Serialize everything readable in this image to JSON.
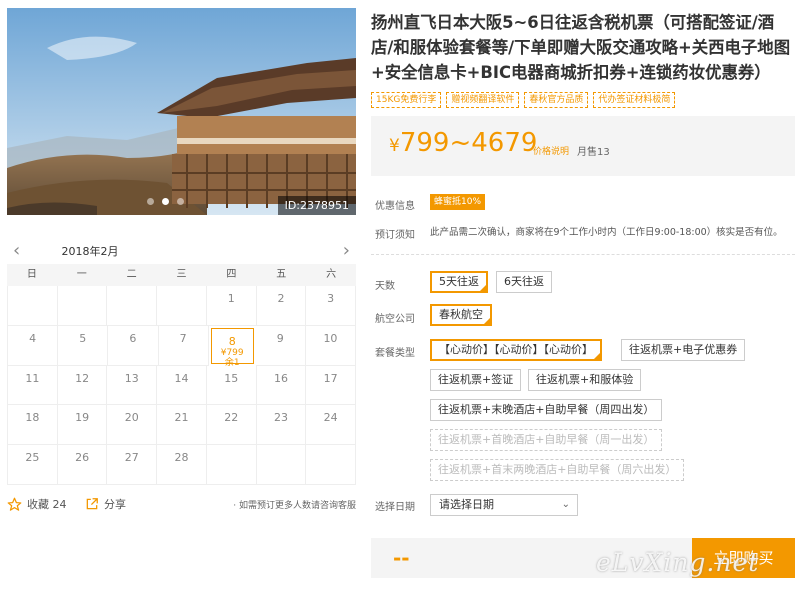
{
  "photo": {
    "id_label": "ID:2378951"
  },
  "calendar": {
    "month": "2018年2月",
    "prev": "‹",
    "next": "›",
    "weekdays": [
      "日",
      "一",
      "二",
      "三",
      "四",
      "五",
      "六"
    ],
    "rows": [
      [
        "",
        "",
        "",
        "",
        "1",
        "2",
        "3"
      ],
      [
        "4",
        "5",
        "6",
        "7",
        "8",
        "9",
        "10"
      ],
      [
        "11",
        "12",
        "13",
        "14",
        "15",
        "16",
        "17"
      ],
      [
        "18",
        "19",
        "20",
        "21",
        "22",
        "23",
        "24"
      ],
      [
        "25",
        "26",
        "27",
        "28",
        "",
        "",
        ""
      ]
    ],
    "available": {
      "day": "8",
      "price": "¥799",
      "remain": "余1"
    }
  },
  "actions": {
    "favorite_label": "收藏 24",
    "share_label": "分享",
    "note": "· 如需预订更多人数请咨询客服"
  },
  "product": {
    "title": "扬州直飞日本大阪5~6日往返含税机票（可搭配签证/酒店/和服体验套餐等/下单即赠大阪交通攻略+关西电子地图+安全信息卡+BIC电器商城折扣券+连锁药妆优惠券）",
    "tags": [
      "15KG免费行李",
      "赠视频翻译软件",
      "春秋官方品质",
      "代办签证材料极简"
    ],
    "price": "799~4679",
    "currency": "¥",
    "price_note": "价格说明",
    "sold": "月售13"
  },
  "info": {
    "promo_label": "优惠信息",
    "promo_badge": "蜂蜜抵10%",
    "notice_label": "预订须知",
    "notice_text": "此产品需二次确认，商家将在9个工作小时内（工作日9:00-18:00）核实是否有位。"
  },
  "options": {
    "days_label": "天数",
    "days": [
      "5天往返",
      "6天往返"
    ],
    "airline_label": "航空公司",
    "airline": "春秋航空",
    "package_label": "套餐类型",
    "packages": [
      "【心动价】【心动价】【心动价】",
      "往返机票+电子优惠券",
      "往返机票+签证",
      "往返机票+和服体验",
      "往返机票+末晚酒店+自助早餐（周四出发）",
      "往返机票+首晚酒店+自助早餐（周一出发）",
      "往返机票+首末两晚酒店+自助早餐（周六出发）"
    ],
    "date_label": "选择日期",
    "date_placeholder": "请选择日期"
  },
  "bottom": {
    "price_placeholder": "--",
    "buy_label": "立即购买",
    "watermark": "eLvXing.net"
  },
  "colors": {
    "accent": "#f39800"
  }
}
